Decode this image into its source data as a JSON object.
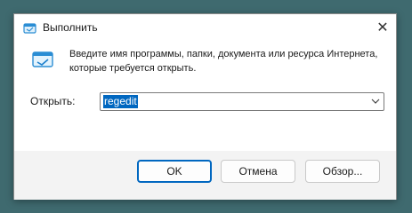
{
  "window": {
    "title": "Выполнить",
    "close_glyph": "✕"
  },
  "dialog": {
    "description": "Введите имя программы, папки, документа или ресурса Интернета, которые требуется открыть.",
    "open_label": "Открыть:",
    "input_value": "regedit"
  },
  "buttons": {
    "ok": "OK",
    "cancel": "Отмена",
    "browse": "Обзор..."
  },
  "icons": {
    "title": "run-icon",
    "main": "run-icon",
    "dropdown": "chevron-down-icon",
    "close": "close-icon"
  },
  "colors": {
    "accent": "#0067c0",
    "background": "#3f6a6f",
    "footer": "#f3f3f3"
  }
}
